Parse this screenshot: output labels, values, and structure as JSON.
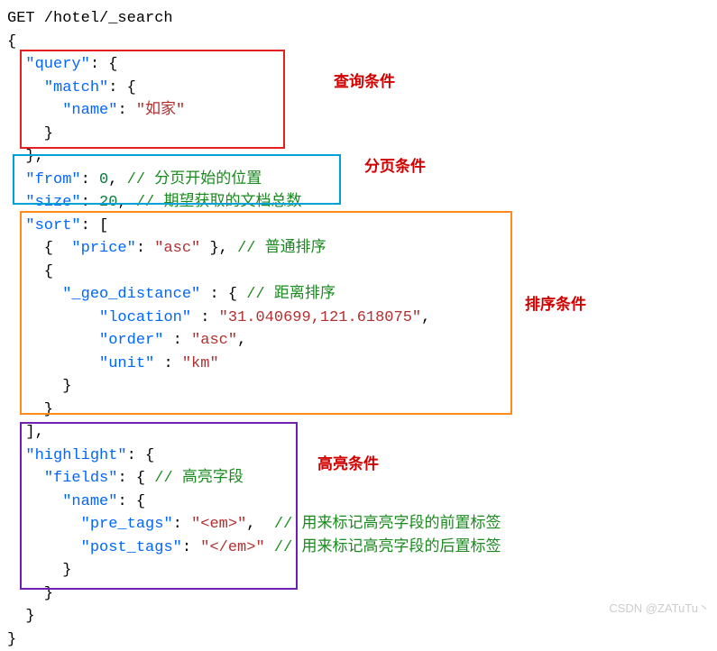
{
  "request_line": "GET /hotel/_search",
  "query": {
    "k_query": "\"query\"",
    "k_match": "\"match\"",
    "k_name": "\"name\"",
    "v_name": "\"如家\""
  },
  "pagination": {
    "k_from": "\"from\"",
    "v_from": "0",
    "c_from": "// 分页开始的位置",
    "k_size": "\"size\"",
    "v_size": "20",
    "c_size": "// 期望获取的文档总数"
  },
  "sort": {
    "k_sort": "\"sort\"",
    "k_price": "\"price\"",
    "v_price": "\"asc\"",
    "c_price": "// 普通排序",
    "k_geo": "\"_geo_distance\"",
    "c_geo": "// 距离排序",
    "k_loc": "\"location\"",
    "v_loc": "\"31.040699,121.618075\"",
    "k_order": "\"order\"",
    "v_order": "\"asc\"",
    "k_unit": "\"unit\"",
    "v_unit": "\"km\""
  },
  "highlight": {
    "k_highlight": "\"highlight\"",
    "k_fields": "\"fields\"",
    "c_fields": "// 高亮字段",
    "k_name": "\"name\"",
    "k_pre": "\"pre_tags\"",
    "v_pre": "\"<em>\"",
    "c_pre": "// 用来标记高亮字段的前置标签",
    "k_post": "\"post_tags\"",
    "v_post": "\"</em>\"",
    "c_post": "// 用来标记高亮字段的后置标签"
  },
  "labels": {
    "query": "查询条件",
    "page": "分页条件",
    "sort": "排序条件",
    "hl": "高亮条件"
  },
  "watermark": "CSDN @ZATuTu丶"
}
